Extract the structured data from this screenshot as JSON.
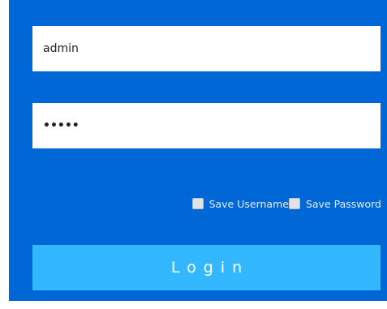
{
  "login_form": {
    "username_value": "admin",
    "password_value": "•••••",
    "save_username_label": "Save Username",
    "save_password_label": "Save Password",
    "login_label": "Login"
  },
  "colors": {
    "panel_background": "#0068d6",
    "login_button": "#33b8ff",
    "field_background": "#ffffff"
  }
}
